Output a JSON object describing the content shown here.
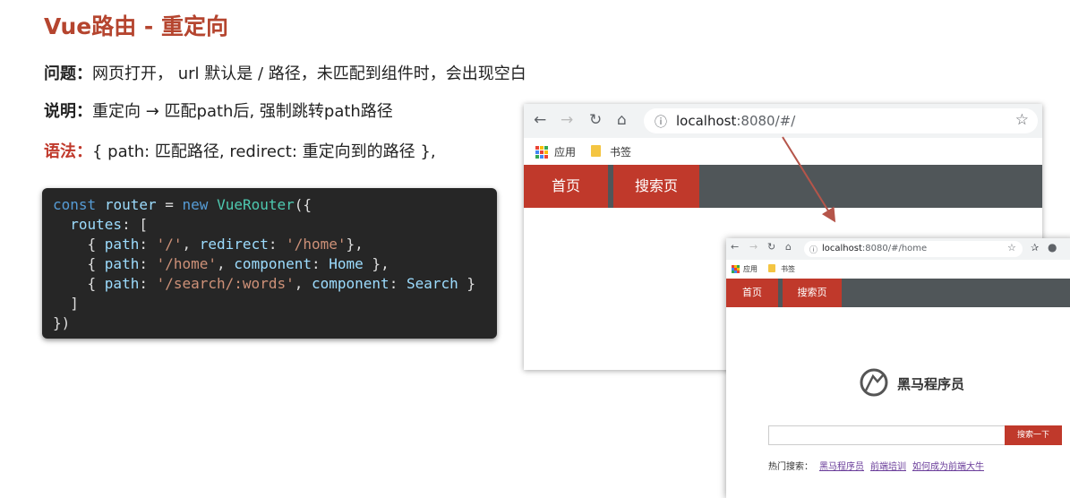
{
  "slide": {
    "title": "Vue路由 - 重定向",
    "lines": [
      {
        "label": "问题：",
        "text": "网页打开， url 默认是 / 路径，未匹配到组件时，会出现空白"
      },
      {
        "label": "说明：",
        "text": "重定向 → 匹配path后, 强制跳转path路径"
      },
      {
        "label": "语法：",
        "text": "{ path: 匹配路径, redirect: 重定向到的路径 },"
      }
    ]
  },
  "code": {
    "l1": {
      "kw": "const",
      "var": "router",
      "eq": " = ",
      "new": "new",
      "cls": "VueRouter",
      "tail": "({"
    },
    "l2": {
      "prop": "routes",
      "tail": ": ["
    },
    "l3": {
      "open": "{ ",
      "k1": "path",
      "c1": ": ",
      "s1": "'/'",
      "sep": ", ",
      "k2": "redirect",
      "c2": ": ",
      "s2": "'/home'",
      "close": "},"
    },
    "l4": {
      "open": "{ ",
      "k1": "path",
      "c1": ": ",
      "s1": "'/home'",
      "sep": ", ",
      "k2": "component",
      "c2": ": ",
      "v2": "Home",
      "close": " },"
    },
    "l5": {
      "open": "{ ",
      "k1": "path",
      "c1": ": ",
      "s1": "'/search/:words'",
      "sep": ", ",
      "k2": "component",
      "c2": ": ",
      "v2": "Search",
      "close": " }"
    },
    "l6": "]",
    "l7": "})"
  },
  "browser1": {
    "url_host": "localhost",
    "url_rest": ":8080/#/",
    "bookmarks": {
      "apps": "应用",
      "folder": "书签"
    },
    "tabs": [
      "首页",
      "搜索页"
    ]
  },
  "browser2": {
    "url_host": "localhost",
    "url_rest": ":8080/#/home",
    "bookmarks": {
      "apps": "应用",
      "folder": "书签"
    },
    "tabs": [
      "首页",
      "搜索页"
    ],
    "brand": "黑马程序员",
    "search_button": "搜索一下",
    "hot_label": "热门搜索：",
    "hot_links": [
      "黑马程序员",
      "前端培训",
      "如何成为前端大牛"
    ]
  },
  "colors": {
    "accent": "#c0392b",
    "title": "#b5452f",
    "nav_bg": "#505659",
    "code_bg": "#262626"
  },
  "icons": [
    "back-icon",
    "forward-icon",
    "reload-icon",
    "home-icon",
    "info-icon",
    "star-icon",
    "extension-icon",
    "profile-icon",
    "apps-icon",
    "folder-icon"
  ]
}
